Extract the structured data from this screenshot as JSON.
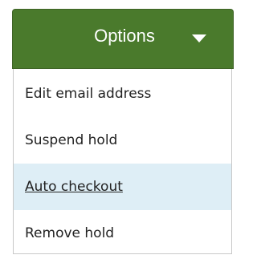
{
  "dropdown": {
    "button_label": "Options",
    "button_color": "#4a7a2c",
    "caret_icon": "caret-down-icon"
  },
  "menu": {
    "items": [
      {
        "label": "Edit email address"
      },
      {
        "label": "Suspend hold"
      },
      {
        "label": "Auto checkout",
        "state": "hovered"
      },
      {
        "label": "Remove hold"
      }
    ],
    "hover_color": "#deeef6"
  }
}
